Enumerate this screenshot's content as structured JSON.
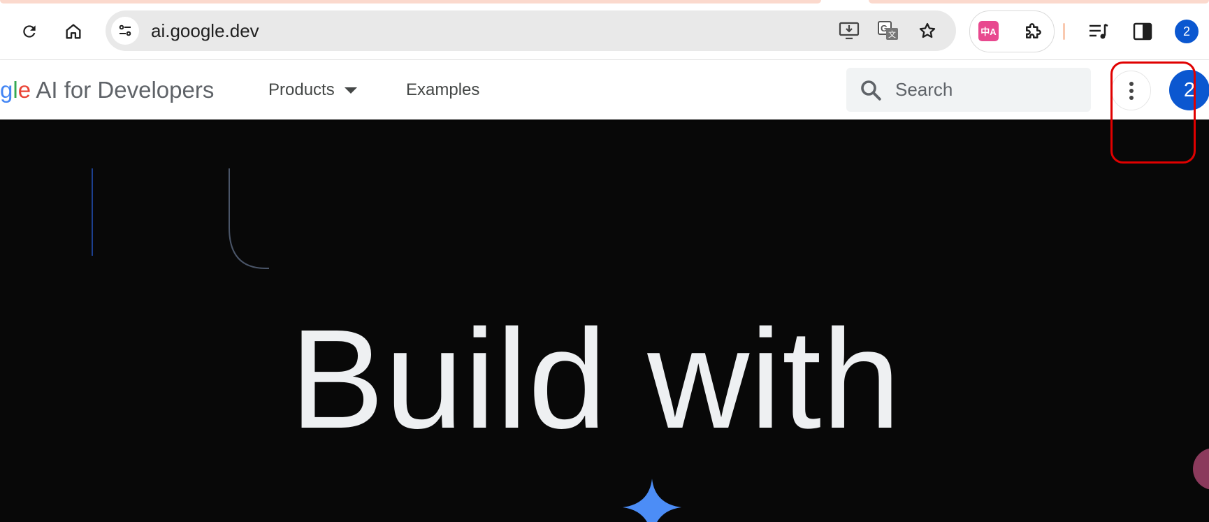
{
  "browser": {
    "url": "ai.google.dev",
    "profile_badge": "2",
    "extension_label": "中A",
    "icons": {
      "reload": "reload-icon",
      "home": "home-icon",
      "site_info": "tune-icon",
      "install": "install-app-icon",
      "translate": "google-translate-icon",
      "bookmark": "star-icon",
      "extensions": "puzzle-icon",
      "media": "media-queue-icon",
      "side_panel": "side-panel-icon"
    }
  },
  "site": {
    "brand_g": "g",
    "brand_l": "l",
    "brand_e": "e",
    "brand_rest": " AI for Developers",
    "nav": [
      {
        "label": "Products",
        "has_dropdown": true
      },
      {
        "label": "Examples",
        "has_dropdown": false
      }
    ],
    "search_placeholder": "Search",
    "account_badge": "2"
  },
  "hero": {
    "headline": "Build with"
  },
  "colors": {
    "accent_blue": "#0b57d0",
    "hero_background": "#080808",
    "highlight": "#e00000",
    "sparkle": "#4c8df6"
  }
}
